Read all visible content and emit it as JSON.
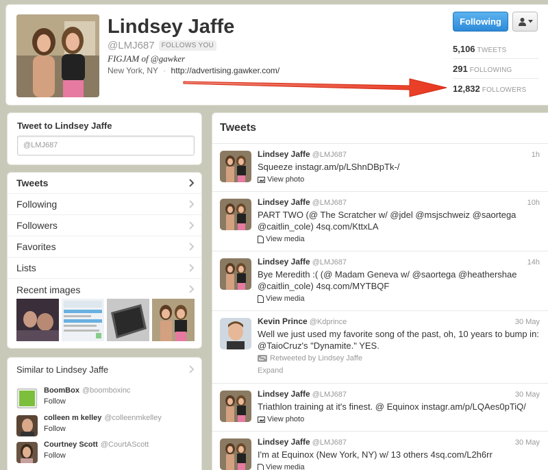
{
  "profile": {
    "name": "Lindsey Jaffe",
    "screen_name": "@LMJ687",
    "follows_you": "FOLLOWS YOU",
    "bio": "FIGJAM of @gawker",
    "location": "New York, NY",
    "separator": "·",
    "url": "http://advertising.gawker.com/",
    "follow_button": "Following",
    "stats": {
      "tweets_count": "5,106",
      "tweets_label": "TWEETS",
      "following_count": "291",
      "following_label": "FOLLOWING",
      "followers_count": "12,832",
      "followers_label": "FOLLOWERS"
    }
  },
  "tweet_box": {
    "title": "Tweet to Lindsey Jaffe",
    "placeholder": "@LMJ687"
  },
  "nav": {
    "items": [
      {
        "label": "Tweets"
      },
      {
        "label": "Following"
      },
      {
        "label": "Followers"
      },
      {
        "label": "Favorites"
      },
      {
        "label": "Lists"
      },
      {
        "label": "Recent images"
      }
    ]
  },
  "similar": {
    "title": "Similar to Lindsey Jaffe",
    "users": [
      {
        "name": "BoomBox",
        "handle": "@boomboxinc",
        "action": "Follow"
      },
      {
        "name": "colleen m kelley",
        "handle": "@colleenmkelley",
        "action": "Follow"
      },
      {
        "name": "Courtney Scott",
        "handle": "@CourtAScott",
        "action": "Follow"
      }
    ]
  },
  "tweets": {
    "title": "Tweets",
    "items": [
      {
        "name": "Lindsey Jaffe",
        "handle": "@LMJ687",
        "time": "1h",
        "text": "Squeeze instagr.am/p/LShnDBpTk-/",
        "action": "View photo"
      },
      {
        "name": "Lindsey Jaffe",
        "handle": "@LMJ687",
        "time": "10h",
        "text": "PART TWO (@ The Scratcher w/ @jdel @msjschweiz @saortega @caitlin_cole) 4sq.com/KttxLA",
        "action": "View media"
      },
      {
        "name": "Lindsey Jaffe",
        "handle": "@LMJ687",
        "time": "14h",
        "text": "Bye Meredith :( (@ Madam Geneva w/ @saortega @heathershae @caitlin_cole) 4sq.com/MYTBQF",
        "action": "View media"
      },
      {
        "name": "Kevin Prince",
        "handle": "@Kdprince",
        "time": "30 May",
        "text": "Well we just used my favorite song of the past, oh, 10 years to bump in: @TaioCruz's \"Dynamite.\" YES.",
        "retweeted": "Retweeted by Lindsey Jaffe",
        "action": "Expand"
      },
      {
        "name": "Lindsey Jaffe",
        "handle": "@LMJ687",
        "time": "30 May",
        "text": "Triathlon training at it's finest. @ Equinox instagr.am/p/LQAes0pTiQ/",
        "action": "View photo"
      },
      {
        "name": "Lindsey Jaffe",
        "handle": "@LMJ687",
        "time": "30 May",
        "text": "I'm at Equinox (New York, NY) w/ 13 others 4sq.com/L2h6rr",
        "action": "View media"
      }
    ]
  },
  "colors": {
    "accent": "#2e8ad8",
    "arrow": "#e8361e",
    "background": "#c9c9b9"
  },
  "icons": [
    "user-icon",
    "caret-down-icon",
    "chevron-right-icon",
    "photo-icon",
    "media-icon",
    "retweet-icon"
  ]
}
